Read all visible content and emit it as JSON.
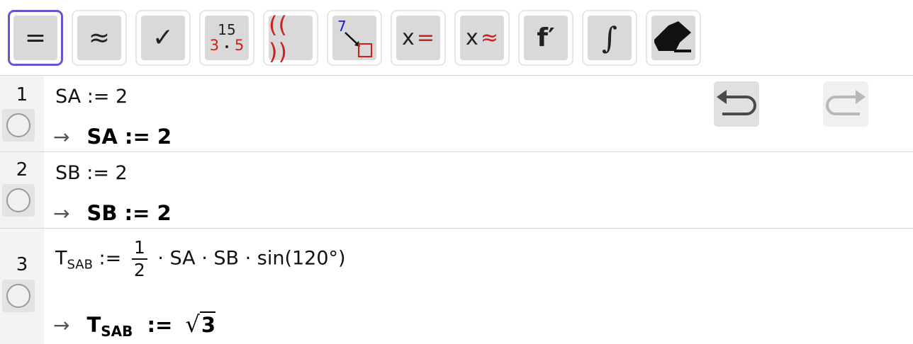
{
  "toolbar": {
    "buttons": [
      {
        "name": "evaluate-button",
        "glyph": "="
      },
      {
        "name": "numeric-button",
        "glyph": "≈"
      },
      {
        "name": "keep-input-button",
        "glyph": "✓"
      },
      {
        "name": "factor-button",
        "top": "15",
        "bottom": [
          "3",
          "•",
          "5"
        ]
      },
      {
        "name": "expand-button",
        "glyph": "(( ))"
      },
      {
        "name": "substitute-button",
        "num": "7"
      },
      {
        "name": "solve-button",
        "x": "x",
        "op": "="
      },
      {
        "name": "solve-numerically-button",
        "x": "x",
        "op": "≈"
      },
      {
        "name": "derivative-button",
        "glyph": "f′"
      },
      {
        "name": "integral-button",
        "glyph": "∫"
      },
      {
        "name": "delete-button",
        "icon": "eraser-icon"
      }
    ]
  },
  "rows": [
    {
      "num": "1",
      "input": "SA := 2",
      "output_prefix": "→",
      "output": "SA := 2"
    },
    {
      "num": "2",
      "input": "SB := 2",
      "output_prefix": "→",
      "output": "SB := 2"
    },
    {
      "num": "3",
      "input": {
        "lhs": "T",
        "lhs_sub": "SAB",
        "assign": ":=",
        "frac_num": "1",
        "frac_den": "2",
        "rest": "· SA · SB · sin(120°)"
      },
      "output_prefix": "→",
      "output": {
        "lhs": "T",
        "lhs_sub": "SAB",
        "assign": ":=",
        "radical": "√",
        "radicand": "3"
      }
    }
  ],
  "colors": {
    "active": "#6557d2",
    "accent_red": "#cc1f1f",
    "accent_blue": "#1a1acc"
  }
}
